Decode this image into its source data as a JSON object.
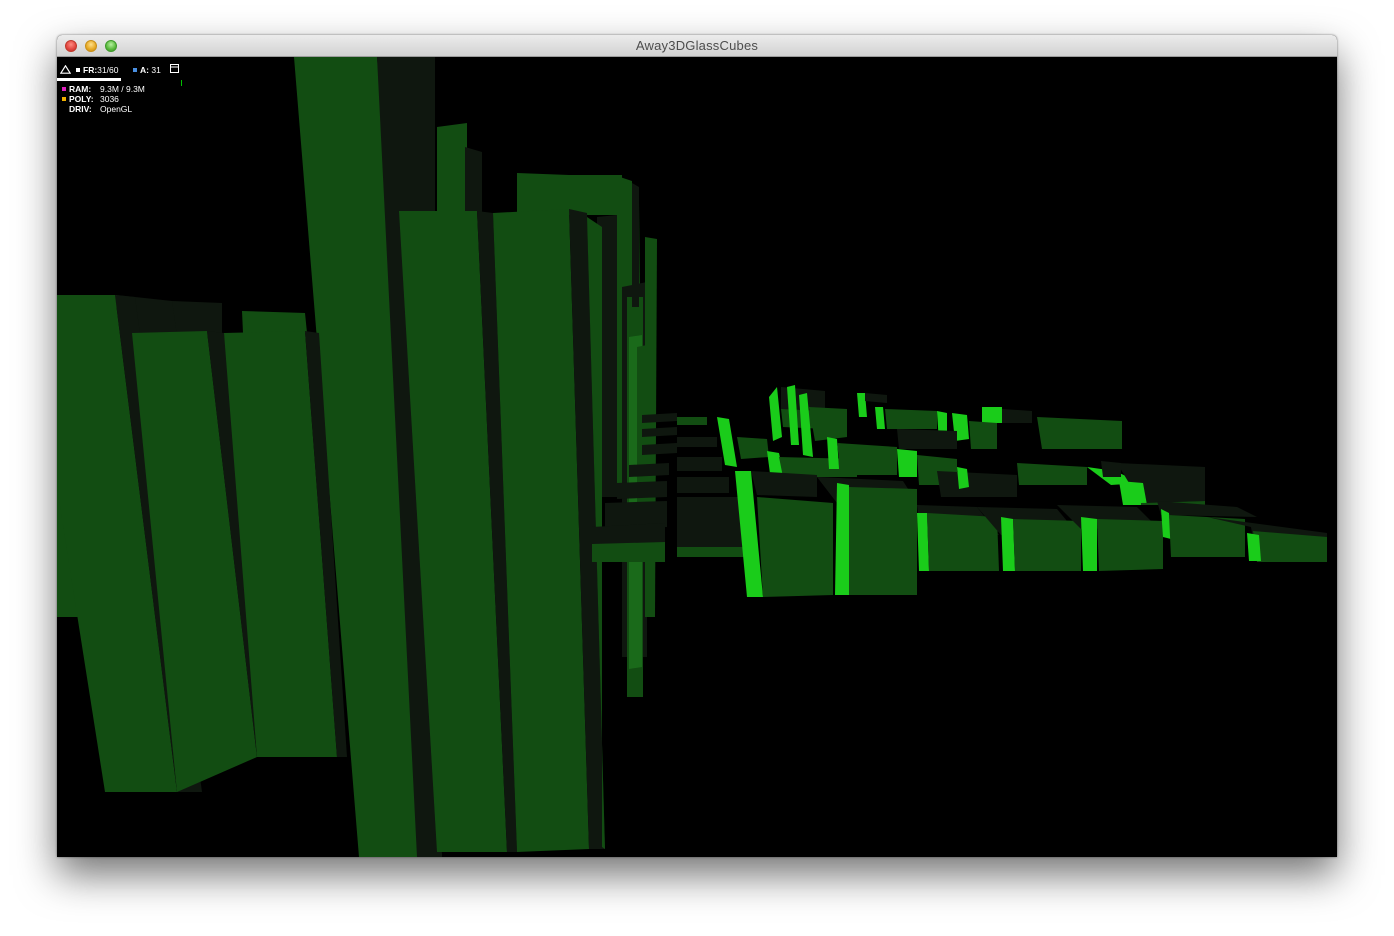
{
  "window": {
    "title": "Away3DGlassCubes"
  },
  "stats": {
    "fr_label": "FR:",
    "fr_value": "31/60",
    "a_label": "A:",
    "a_value": "31",
    "ram_label": "RAM:",
    "ram_value": "9.3M / 9.3M",
    "poly_label": "POLY:",
    "poly_value": "3036",
    "driv_label": "DRIV:",
    "driv_value": "OpenGL",
    "icons": [
      "triangle-logo-icon",
      "minimize-box-icon"
    ]
  },
  "colors": {
    "background": "#000000",
    "cube_dark": "#124d12",
    "cube_shadow": "#0f170f",
    "cube_bright": "#1acc1a",
    "fr_square": "#ffffff",
    "a_square": "#4a90e2",
    "ram_square": "#e020c0",
    "poly_square": "#f0b000"
  }
}
